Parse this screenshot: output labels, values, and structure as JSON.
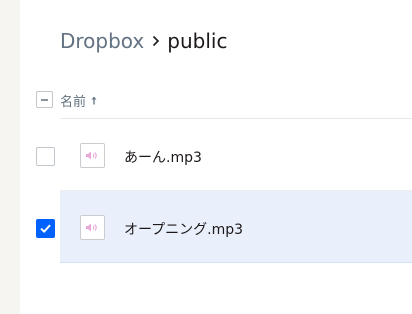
{
  "breadcrumb": {
    "root": "Dropbox",
    "separator_icon": "chevron-right-icon",
    "current": "public"
  },
  "table": {
    "header": {
      "name_label": "名前",
      "sort_icon": "arrow-up-icon",
      "sort_direction": "ascending"
    },
    "rows": [
      {
        "name": "あーん.mp3",
        "icon": "audio-file-icon",
        "selected": false
      },
      {
        "name": "オープニング.mp3",
        "icon": "audio-file-icon",
        "selected": true
      }
    ]
  },
  "colors": {
    "accent": "#0061fe",
    "selected_row_bg": "#e9f0fb",
    "audio_icon": "#e7a6d8",
    "muted_text": "#637282"
  }
}
